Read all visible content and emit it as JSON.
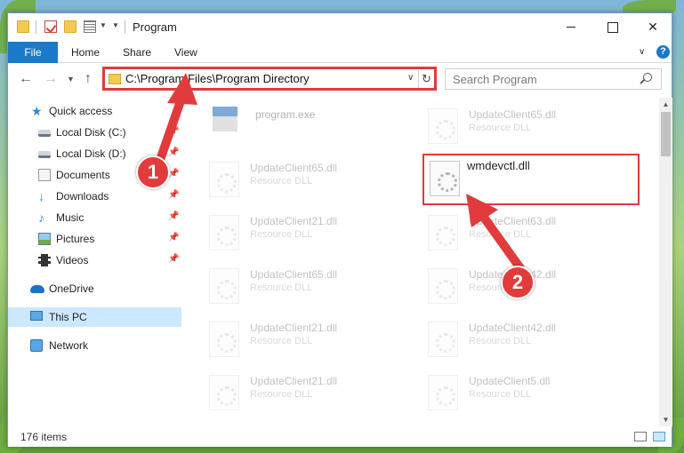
{
  "window": {
    "title": "Program"
  },
  "ribbon": {
    "file": "File",
    "home": "Home",
    "share": "Share",
    "view": "View"
  },
  "address": {
    "path": "C:\\Program Files\\Program Directory"
  },
  "search": {
    "placeholder": "Search Program"
  },
  "sidebar": {
    "quick_access": "Quick access",
    "items": [
      {
        "label": "Local Disk (C:)",
        "icon": "drive-icon",
        "pinned": true
      },
      {
        "label": "Local Disk (D:)",
        "icon": "drive-icon",
        "pinned": true
      },
      {
        "label": "Documents",
        "icon": "documents-icon",
        "pinned": true
      },
      {
        "label": "Downloads",
        "icon": "downloads-icon",
        "pinned": true
      },
      {
        "label": "Music",
        "icon": "music-icon",
        "pinned": true
      },
      {
        "label": "Pictures",
        "icon": "pictures-icon",
        "pinned": true
      },
      {
        "label": "Videos",
        "icon": "videos-icon",
        "pinned": true
      }
    ],
    "onedrive": "OneDrive",
    "this_pc": "This PC",
    "network": "Network"
  },
  "files": [
    {
      "name": "program.exe",
      "type": ""
    },
    {
      "name": "UpdateClient65.dll",
      "type": "Resource DLL"
    },
    {
      "name": "UpdateClient65.dll",
      "type": "Resource DLL"
    },
    {
      "name": "wmdevctl.dll",
      "type": ""
    },
    {
      "name": "UpdateClient21.dll",
      "type": "Resource DLL"
    },
    {
      "name": "UpdateClient63.dll",
      "type": "Resource DLL"
    },
    {
      "name": "UpdateClient65.dll",
      "type": "Resource DLL"
    },
    {
      "name": "UpdateClient42.dll",
      "type": "Resource DLL"
    },
    {
      "name": "UpdateClient21.dll",
      "type": "Resource DLL"
    },
    {
      "name": "UpdateClient42.dll",
      "type": "Resource DLL"
    },
    {
      "name": "UpdateClient21.dll",
      "type": "Resource DLL"
    },
    {
      "name": "UpdateClient5.dll",
      "type": "Resource DLL"
    }
  ],
  "status": {
    "item_count": "176 items"
  },
  "callouts": {
    "one": "1",
    "two": "2"
  },
  "colors": {
    "accent": "#1979ca",
    "highlight": "#e03a3a",
    "selected": "#cce8ff"
  }
}
